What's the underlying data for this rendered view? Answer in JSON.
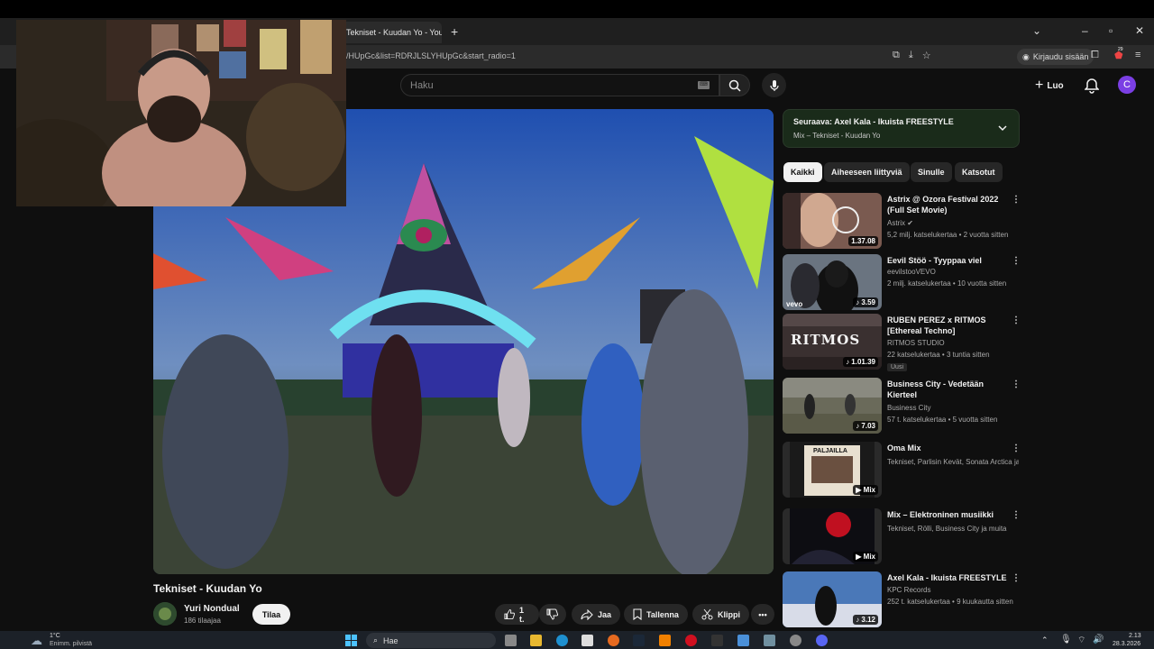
{
  "browser": {
    "tab_title": "Tekniset - Kuudan Yo - You",
    "url": "/HUpGc&list=RDRJLSLYHUpGc&start_radio=1",
    "signin_label": "Kirjaudu sisään",
    "extension_badge": "29"
  },
  "header": {
    "search_placeholder": "Haku",
    "create_label": "Luo",
    "avatar_letter": "C"
  },
  "video": {
    "title": "Tekniset - Kuudan Yo",
    "channel": "Yuri Nondual",
    "subscribers": "186 tilaajaa",
    "subscribe_label": "Tilaa",
    "like_count": "1 t.",
    "share_label": "Jaa",
    "save_label": "Tallenna",
    "clip_label": "Klippi"
  },
  "next_up": {
    "title": "Seuraava: Axel Kala - Ikuista FREESTYLE",
    "subtitle": "Mix – Tekniset - Kuudan Yo"
  },
  "chips": [
    "Kaikki",
    "Aiheeseen liittyviä",
    "Sinulle",
    "Katsotut"
  ],
  "recommendations": [
    {
      "title": "Astrix @ Ozora Festival 2022 (Full Set Movie)",
      "channel": "Astrix",
      "meta": "5,2 milj. katselukertaa • 2 vuotta sitten",
      "duration": "1.37.08",
      "badge": ""
    },
    {
      "title": "Eevil Stöö - Tyyppaa viel",
      "channel": "eevilstooVEVO",
      "meta": "2 milj. katselukertaa • 10 vuotta sitten",
      "duration": "3.59",
      "badge": ""
    },
    {
      "title": "RUBEN PEREZ x RITMOS [Ethereal Techno]",
      "channel": "RITMOS STUDIO",
      "meta": "22 katselukertaa • 3 tuntia sitten",
      "duration": "1.01.39",
      "badge": "Uusi"
    },
    {
      "title": "Business City - Vedetään Kierteel",
      "channel": "Business City",
      "meta": "57 t. katselukertaa • 5 vuotta sitten",
      "duration": "7.03",
      "badge": ""
    },
    {
      "title": "Oma Mix",
      "channel": "Tekniset, Parlisin Kevät, Sonata Arctica ja muita",
      "meta": "",
      "duration": "Mix",
      "badge": ""
    },
    {
      "title": "Mix – Elektroninen musiikki",
      "channel": "Tekniset, Rölli, Business City ja muita",
      "meta": "",
      "duration": "Mix",
      "badge": ""
    },
    {
      "title": "Axel Kala - Ikuista FREESTYLE",
      "channel": "KPC Records",
      "meta": "252 t. katselukertaa • 9 kuukautta sitten",
      "duration": "3.12",
      "badge": ""
    }
  ],
  "thumb_texts": {
    "ritmos": "RITMOS",
    "paljailla": "PALJAILLA",
    "vevo": "vevo"
  },
  "taskbar": {
    "temp": "1°C",
    "weather": "Enimm. pilvistä",
    "search_label": "Hae",
    "time": "2.13",
    "date": "28.3.2026"
  },
  "colors": {
    "background": "#0f0f0f",
    "chip_active": "#f1f1f1",
    "avatar": "#7b3fe4",
    "progress_red": "#ff0033"
  }
}
